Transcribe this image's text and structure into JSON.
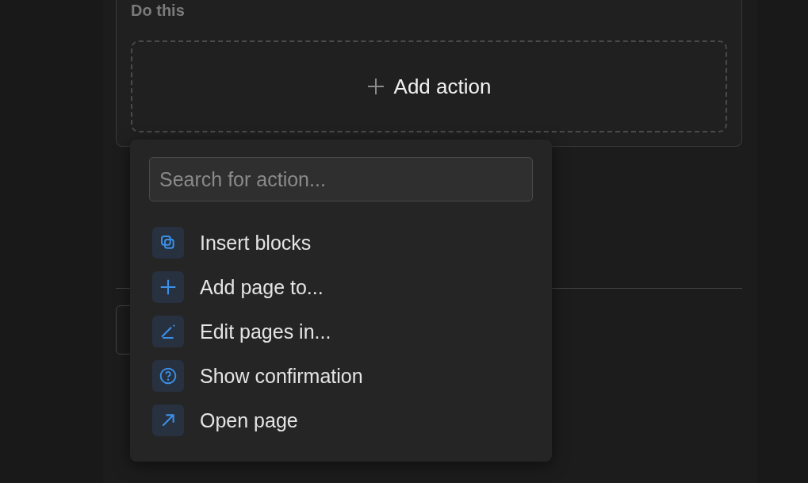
{
  "section": {
    "label": "Do this",
    "add_button": {
      "label": "Add action"
    }
  },
  "menu": {
    "search": {
      "placeholder": "Search for action..."
    },
    "items": [
      {
        "label": "Insert blocks"
      },
      {
        "label": "Add page to..."
      },
      {
        "label": "Edit pages in..."
      },
      {
        "label": "Show confirmation"
      },
      {
        "label": "Open page"
      }
    ]
  }
}
